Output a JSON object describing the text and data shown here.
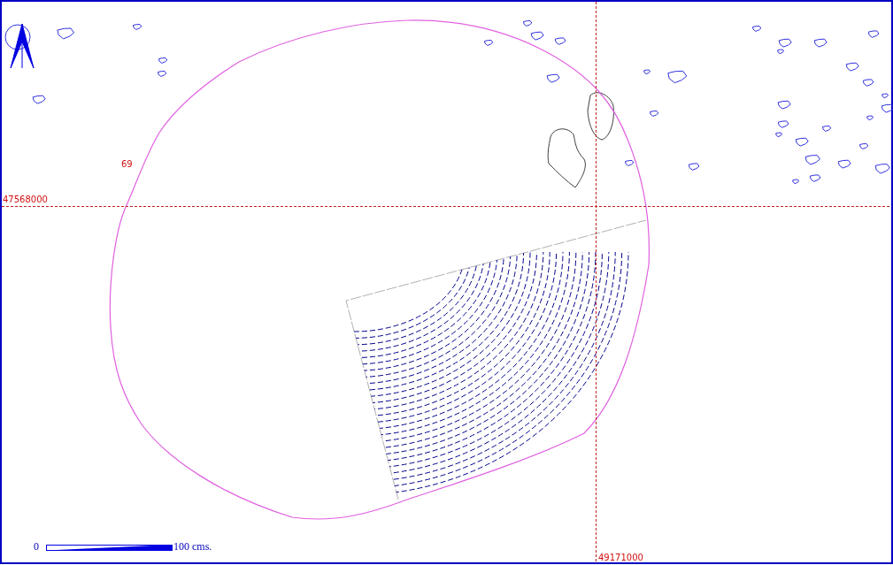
{
  "point_label": "69",
  "grid": {
    "northing_label": "47568000",
    "easting_label": "49171000"
  },
  "scale_bar": {
    "start": "0",
    "end": "100 cms."
  }
}
